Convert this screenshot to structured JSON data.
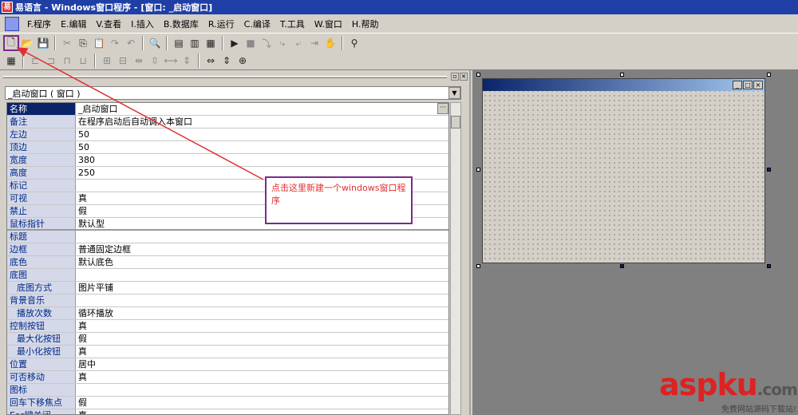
{
  "title_bar": {
    "text": "易语言 - Windows窗口程序 - [窗口: _启动窗口]"
  },
  "menu": [
    "F.程序",
    "E.编辑",
    "V.查看",
    "I.插入",
    "B.数据库",
    "R.运行",
    "C.编译",
    "T.工具",
    "W.窗口",
    "H.帮助"
  ],
  "toolbar1": [
    {
      "icon": "new-file-icon",
      "glyph": "🗋",
      "dim": false
    },
    {
      "icon": "open-folder-icon",
      "glyph": "📂",
      "dim": false
    },
    {
      "icon": "save-icon",
      "glyph": "💾",
      "dim": false
    },
    {
      "sep": true
    },
    {
      "icon": "cut-icon",
      "glyph": "✂",
      "dim": true
    },
    {
      "icon": "copy-icon",
      "glyph": "⎘",
      "dim": false
    },
    {
      "icon": "paste-icon",
      "glyph": "📋",
      "dim": false
    },
    {
      "icon": "redo-icon",
      "glyph": "↷",
      "dim": true
    },
    {
      "icon": "undo-icon",
      "glyph": "↶",
      "dim": true
    },
    {
      "sep": true
    },
    {
      "icon": "find-icon",
      "glyph": "🔍",
      "dim": false
    },
    {
      "sep": true
    },
    {
      "icon": "layout-1-icon",
      "glyph": "▤",
      "dim": false
    },
    {
      "icon": "layout-2-icon",
      "glyph": "▥",
      "dim": false
    },
    {
      "icon": "layout-3-icon",
      "glyph": "▦",
      "dim": false
    },
    {
      "sep": true
    },
    {
      "icon": "run-icon",
      "glyph": "▶",
      "dim": false
    },
    {
      "icon": "stop-icon",
      "glyph": "■",
      "dim": true
    },
    {
      "icon": "step-1-icon",
      "glyph": "⤵",
      "dim": true
    },
    {
      "icon": "step-2-icon",
      "glyph": "⤷",
      "dim": true
    },
    {
      "icon": "step-3-icon",
      "glyph": "⤶",
      "dim": true
    },
    {
      "icon": "step-4-icon",
      "glyph": "⇥",
      "dim": true
    },
    {
      "icon": "hand-icon",
      "glyph": "✋",
      "dim": true
    },
    {
      "sep": true
    },
    {
      "icon": "binoculars-icon",
      "glyph": "⚲",
      "dim": false
    }
  ],
  "toolbar2": [
    {
      "icon": "grid-icon",
      "glyph": "▦",
      "dim": false
    },
    {
      "sep": true
    },
    {
      "icon": "align-left-icon",
      "glyph": "⊏",
      "dim": true
    },
    {
      "icon": "align-right-icon",
      "glyph": "⊐",
      "dim": true
    },
    {
      "icon": "align-top-icon",
      "glyph": "⊓",
      "dim": true
    },
    {
      "icon": "align-bottom-icon",
      "glyph": "⊔",
      "dim": true
    },
    {
      "sep": true
    },
    {
      "icon": "center-h-icon",
      "glyph": "⊞",
      "dim": true
    },
    {
      "icon": "center-v-icon",
      "glyph": "⊟",
      "dim": true
    },
    {
      "icon": "space-h-icon",
      "glyph": "⇹",
      "dim": true
    },
    {
      "icon": "space-v-icon",
      "glyph": "⇳",
      "dim": true
    },
    {
      "icon": "same-width-icon",
      "glyph": "⟷",
      "dim": true
    },
    {
      "icon": "same-height-icon",
      "glyph": "⇕",
      "dim": true
    },
    {
      "sep": true
    },
    {
      "icon": "center-form-h-icon",
      "glyph": "⇔",
      "dim": false
    },
    {
      "icon": "center-form-v-icon",
      "glyph": "⇕",
      "dim": false
    },
    {
      "icon": "center-form-icon",
      "glyph": "⊕",
      "dim": false
    }
  ],
  "object_selector": {
    "value": "_启动窗口 ( 窗口 )"
  },
  "properties": [
    {
      "name": "名称",
      "value": "_启动窗口",
      "selected": true,
      "button": "···"
    },
    {
      "name": "备注",
      "value": "在程序启动后自动调入本窗口"
    },
    {
      "name": "左边",
      "value": "50"
    },
    {
      "name": "顶边",
      "value": "50"
    },
    {
      "name": "宽度",
      "value": "380"
    },
    {
      "name": "高度",
      "value": "250"
    },
    {
      "name": "标记",
      "value": ""
    },
    {
      "name": "可视",
      "value": "真"
    },
    {
      "name": "禁止",
      "value": "假"
    },
    {
      "name": "鼠标指针",
      "value": "默认型",
      "sep": true
    },
    {
      "name": "标题",
      "value": ""
    },
    {
      "name": "边框",
      "value": "普通固定边框"
    },
    {
      "name": "底色",
      "value": "默认底色"
    },
    {
      "name": "底图",
      "value": ""
    },
    {
      "name": "底图方式",
      "value": "图片平铺",
      "sub": true
    },
    {
      "name": "背景音乐",
      "value": ""
    },
    {
      "name": "播放次数",
      "value": "循环播放",
      "sub": true
    },
    {
      "name": "控制按钮",
      "value": "真"
    },
    {
      "name": "最大化按钮",
      "value": "假",
      "sub": true
    },
    {
      "name": "最小化按钮",
      "value": "真",
      "sub": true
    },
    {
      "name": "位置",
      "value": "居中"
    },
    {
      "name": "可否移动",
      "value": "真"
    },
    {
      "name": "图标",
      "value": ""
    },
    {
      "name": "回车下移焦点",
      "value": "假"
    },
    {
      "name": "Esc键关闭",
      "value": "真"
    }
  ],
  "annotation": {
    "text": "点击这里新建一个windows窗口程序",
    "color": "#e03030",
    "border_color": "#7b2a8e"
  },
  "watermark": {
    "main": "aspku",
    "suffix": ".com",
    "sub": "免费网站源码下载站!"
  },
  "colors": {
    "title_bar": "#1f3fa6",
    "selection": "#0a246a",
    "face": "#d4d0c8"
  }
}
